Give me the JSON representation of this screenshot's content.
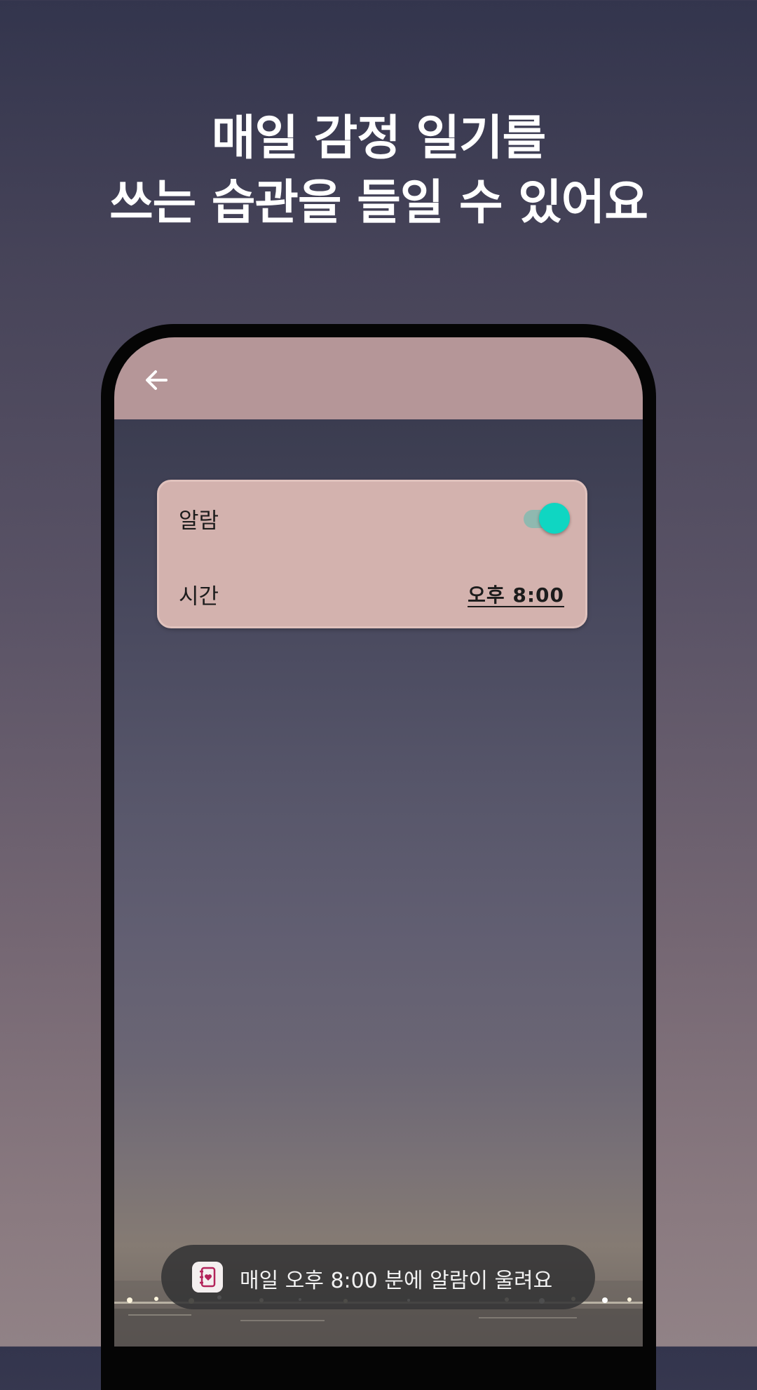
{
  "headline": {
    "line1": "매일 감정 일기를",
    "line2": "쓰는 습관을 들일 수 있어요"
  },
  "appbar": {
    "back_icon": "arrow-left-icon"
  },
  "settings": {
    "alarm_label": "알람",
    "alarm_enabled": true,
    "time_label": "시간",
    "time_value": "오후 8:00"
  },
  "toast": {
    "app_icon": "diary-heart-icon",
    "message": "매일 오후 8:00 분에 알람이 울려요"
  },
  "colors": {
    "appbar": "#b59698",
    "card": "#d3b2ae",
    "toggle_thumb": "#0fd6c2",
    "toggle_track": "#8fb9b0",
    "toast_background": "#343436",
    "app_icon_accent": "#b3245a"
  }
}
